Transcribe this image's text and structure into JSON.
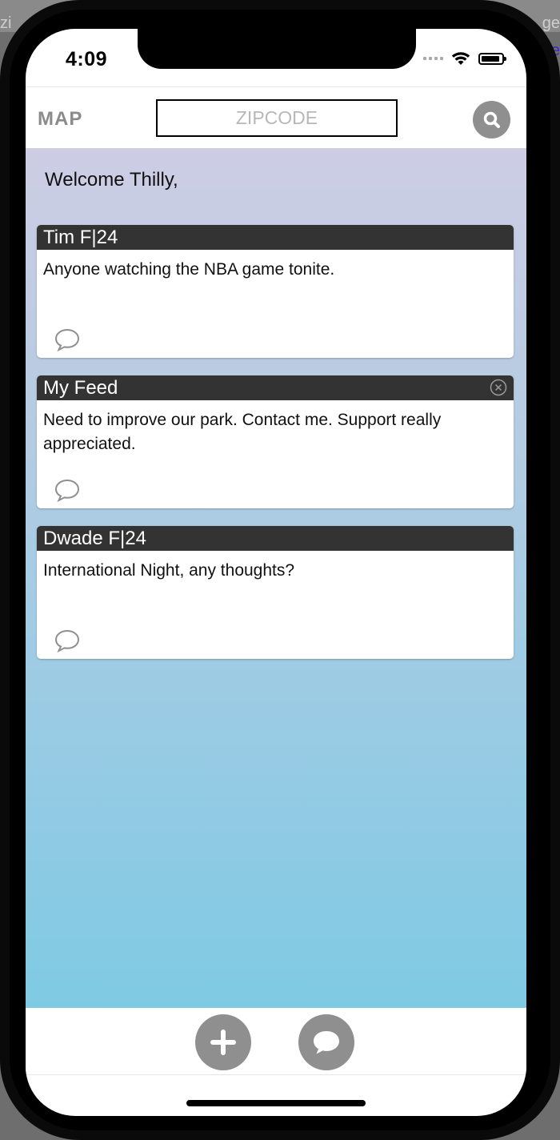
{
  "background": {
    "left_text": "zi",
    "right_text": "ge",
    "right_text2": "e"
  },
  "status_bar": {
    "time": "4:09"
  },
  "header": {
    "map_label": "MAP",
    "zip_placeholder": "ZIPCODE",
    "zip_value": ""
  },
  "welcome": "Welcome Thilly,",
  "posts": [
    {
      "author": "Tim F|24",
      "text": "Anyone watching the NBA game tonite."
    },
    {
      "author": "My Feed",
      "text": "Need to improve our park. Contact me. Support really appreciated."
    },
    {
      "author": "Dwade F|24",
      "text": "International Night, any thoughts?"
    }
  ],
  "colors": {
    "card_header": "#333333",
    "button_gray": "#8f8f8f",
    "gradient_top": "#cdcde4",
    "gradient_bottom": "#7fcae3"
  },
  "icons": {
    "search": "search-icon",
    "comment": "comment-icon",
    "close": "close-circle-icon",
    "add": "plus-icon",
    "chat": "chat-bubble-icon"
  }
}
